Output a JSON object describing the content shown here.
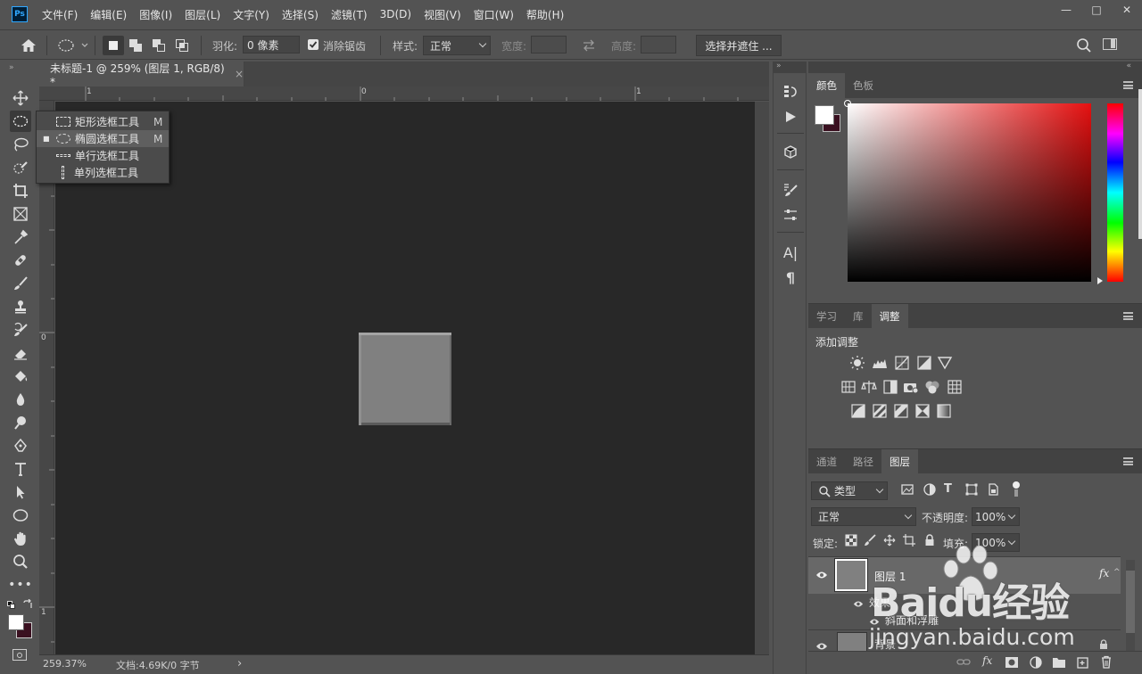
{
  "app": {
    "logo": "Ps"
  },
  "menu": [
    "文件(F)",
    "编辑(E)",
    "图像(I)",
    "图层(L)",
    "文字(Y)",
    "选择(S)",
    "滤镜(T)",
    "3D(D)",
    "视图(V)",
    "窗口(W)",
    "帮助(H)"
  ],
  "window_controls": {
    "minimize": "—",
    "maximize": "□",
    "close": "✕"
  },
  "options": {
    "feather_label": "羽化:",
    "feather_value": "0 像素",
    "antialias_label": "消除锯齿",
    "antialias_checked": true,
    "style_label": "样式:",
    "style_value": "正常",
    "width_label": "宽度:",
    "height_label": "高度:",
    "select_mask_button": "选择并遮住 ..."
  },
  "document": {
    "tab_title": "未标题-1 @ 259% (图层 1, RGB/8) *",
    "close": "×",
    "ruler_top_labels": [
      "1",
      "0",
      "1"
    ],
    "ruler_left_labels": [
      "0",
      "1"
    ],
    "zoom": "259.37%",
    "doc_info": "文档:4.69K/0 字节",
    "status_arrow": "›"
  },
  "flyout": {
    "items": [
      {
        "label": "矩形选框工具",
        "shortcut": "M",
        "icon": "rect-marquee-icon",
        "active": false
      },
      {
        "label": "椭圆选框工具",
        "shortcut": "M",
        "icon": "ellipse-marquee-icon",
        "active": true
      },
      {
        "label": "单行选框工具",
        "shortcut": "",
        "icon": "single-row-marquee-icon",
        "active": false
      },
      {
        "label": "单列选框工具",
        "shortcut": "",
        "icon": "single-column-marquee-icon",
        "active": false
      }
    ]
  },
  "color_panel": {
    "tabs": [
      "颜色",
      "色板"
    ],
    "active": "颜色",
    "foreground": "#ffffff",
    "background": "#3a1020",
    "hue_color": "#e51010"
  },
  "adjust_panel": {
    "tabs": [
      "学习",
      "库",
      "调整"
    ],
    "active": "调整",
    "title": "添加调整"
  },
  "layers_panel": {
    "tabs": [
      "通道",
      "路径",
      "图层"
    ],
    "active": "图层",
    "filter_label": "类型",
    "blend_mode": "正常",
    "opacity_label": "不透明度:",
    "opacity_value": "100%",
    "lock_label": "锁定:",
    "fill_label": "填充:",
    "fill_value": "100%",
    "fx": "fx",
    "layers": [
      {
        "name": "图层 1",
        "effects_label": "效果",
        "effect": "斜面和浮雕"
      },
      {
        "name": "背景"
      }
    ]
  },
  "watermark": {
    "brand": "Baidu经验",
    "url": "jingyan.baidu.com"
  },
  "colors": {
    "ui_bg": "#535353",
    "canvas_bg": "#282828",
    "shape": "#808080",
    "accent": "#31a8ff"
  }
}
